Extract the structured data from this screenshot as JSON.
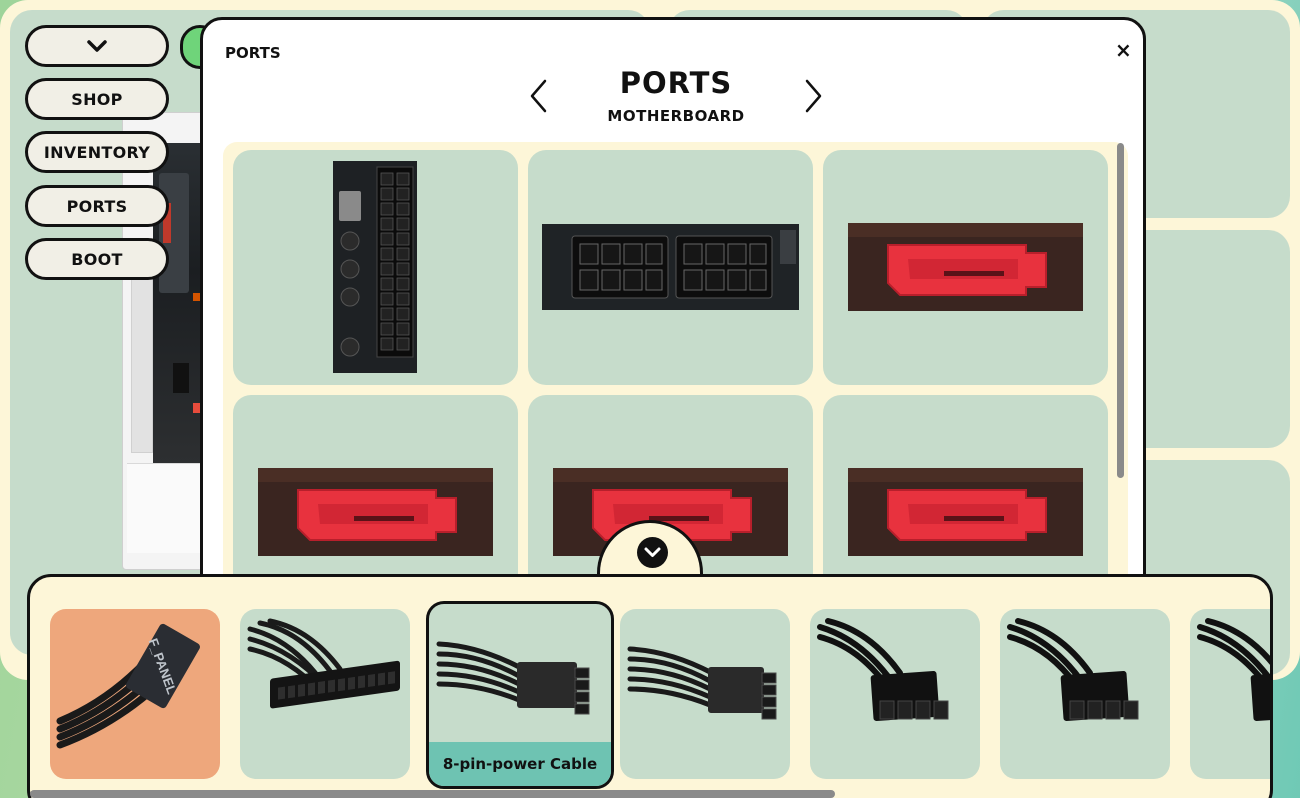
{
  "sidebar": {
    "items": [
      {
        "label": "SHOP"
      },
      {
        "label": "INVENTORY"
      },
      {
        "label": "PORTS"
      },
      {
        "label": "BOOT"
      }
    ]
  },
  "modal": {
    "tag": "PORTS",
    "close": "×",
    "title": "PORTS",
    "subtitle": "MOTHERBOARD",
    "ports": [
      {
        "icon": "atx-24pin-header-icon"
      },
      {
        "icon": "eps-8pin-header-icon"
      },
      {
        "icon": "sata-port-icon"
      },
      {
        "icon": "sata-port-icon"
      },
      {
        "icon": "sata-port-icon"
      },
      {
        "icon": "sata-port-icon"
      }
    ]
  },
  "drawer": {
    "cables": [
      {
        "icon": "f-panel-cable-icon",
        "label": "",
        "print": "F_PANEL"
      },
      {
        "icon": "atx-24pin-cable-icon",
        "label": ""
      },
      {
        "icon": "8pin-cable-icon",
        "label": "8-pin-power Cable",
        "selected": true
      },
      {
        "icon": "8pin-cable-icon",
        "label": ""
      },
      {
        "icon": "eps-cable-icon",
        "label": ""
      },
      {
        "icon": "eps-cable-icon",
        "label": ""
      },
      {
        "icon": "eps-cable-icon",
        "label": ""
      }
    ]
  },
  "colors": {
    "cream": "#fdf6d8",
    "tile": "#c6dccb",
    "f_panel_tile": "#eea77c",
    "selected_label": "#6ec3b2",
    "sata_red": "#e8323e"
  }
}
